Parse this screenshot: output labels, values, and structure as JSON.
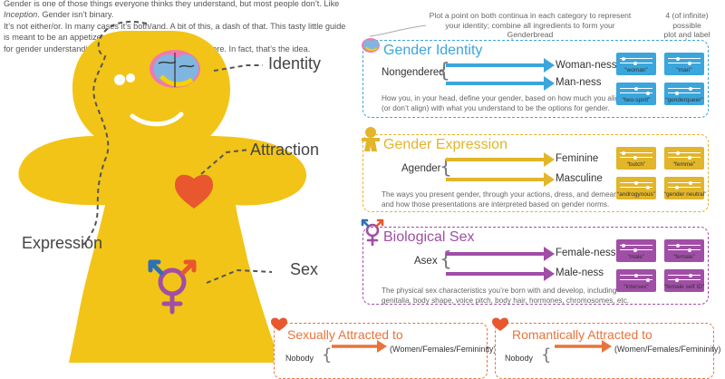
{
  "intro": {
    "line1a": "Gender is one of those things everyone thinks they understand, but most people don’t. Like ",
    "line1i": "Inception",
    "line1b": ". Gender isn’t binary.",
    "line2": "It’s not either/or.  In many cases it’s both/and. A bit of this, a dash of that. This tasty little guide is meant to be an appetizer",
    "line3": "for gender understanding. It’s okay if you’re hungry for more. In fact, that’s the idea."
  },
  "callouts": {
    "plot_line1": "Plot a point on both continua in each category to represent",
    "plot_line2": "your identity; combine all ingredients to form your Genderbread",
    "combos_line1": "4 (of infinite) possible",
    "combos_line2": "plot and label combos"
  },
  "figure_labels": {
    "identity": "Identity",
    "attraction": "Attraction",
    "expression": "Expression",
    "sex": "Sex"
  },
  "colors": {
    "identity": "#3aa6dc",
    "expression": "#e2b52a",
    "sex": "#a04ea6",
    "attraction": "#e8743b",
    "gingerbread": "#f2c417",
    "heart": "#e8572e"
  },
  "sections": [
    {
      "key": "identity",
      "icon": "brain-icon",
      "title": "Gender Identity",
      "left": "Nongendered",
      "top_end": "Woman-ness",
      "bottom_end": "Man-ness",
      "desc1": "How you, in your head, define your gender, based on how much you align",
      "desc2": "(or don’t align) with what you understand to be the options for gender.",
      "cards": [
        "“woman”",
        "“man”",
        "“two-spirit”",
        "“genderqueer”"
      ]
    },
    {
      "key": "expression",
      "icon": "gingerbread-person-icon",
      "title": "Gender Expression",
      "left": "Agender",
      "top_end": "Feminine",
      "bottom_end": "Masculine",
      "desc1": "The ways you present gender, through your actions, dress, and demeanor,",
      "desc2": "and how those presentations are interpreted based on gender norms.",
      "cards": [
        "“butch”",
        "“femme”",
        "“androgynous”",
        "“gender neutral”"
      ]
    },
    {
      "key": "sex",
      "icon": "gender-symbol-icon",
      "title": "Biological Sex",
      "left": "Asex",
      "top_end": "Female-ness",
      "bottom_end": "Male-ness",
      "desc1": "The physical sex characteristics you’re born with and develop, including",
      "desc2": "genitalia, body shape, voice pitch, body hair, hormones, chromosomes, etc.",
      "cards": [
        "“male”",
        "“female”",
        "“intersex”",
        "“female self ID”"
      ]
    }
  ],
  "attraction": {
    "sexual_title": "Sexually Attracted to",
    "romantic_title": "Romantically Attracted to",
    "nobody": "Nobody",
    "women_label": "(Women/Females/Femininity)"
  }
}
